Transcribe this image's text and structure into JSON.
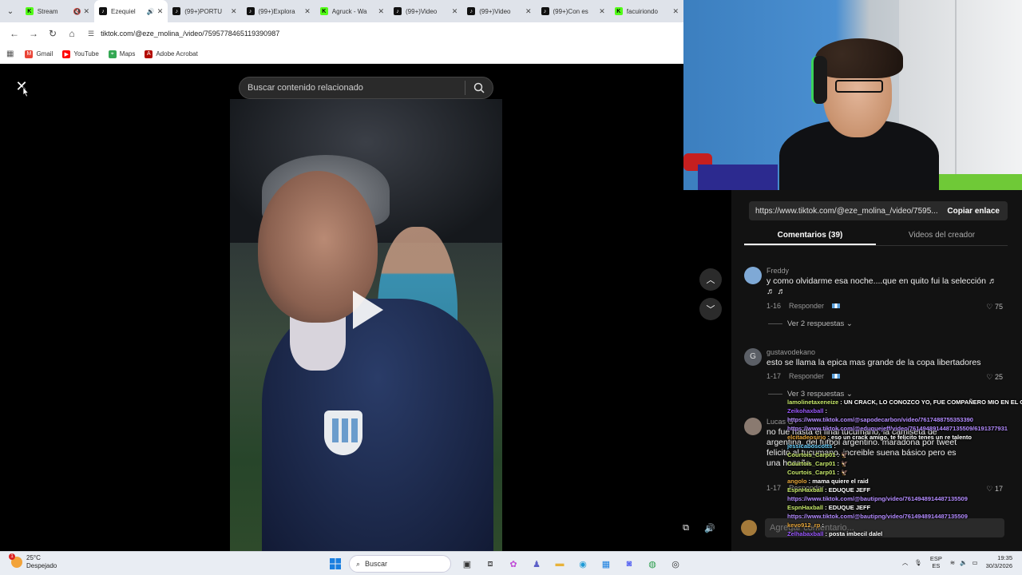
{
  "browser": {
    "tabs": [
      {
        "label": "Stream",
        "favicon": "kick",
        "active": false,
        "muted": true
      },
      {
        "label": "Ezequiel",
        "favicon": "tiktok",
        "active": true,
        "sound": true
      },
      {
        "label": "(99+)PORTU",
        "favicon": "tiktok",
        "active": false
      },
      {
        "label": "(99+)Explora",
        "favicon": "tiktok",
        "active": false
      },
      {
        "label": "Agruck - Wa",
        "favicon": "kick",
        "active": false
      },
      {
        "label": "(99+)Video",
        "favicon": "tiktok",
        "active": false
      },
      {
        "label": "(99+)Video",
        "favicon": "tiktok",
        "active": false
      },
      {
        "label": "(99+)Con es",
        "favicon": "tiktok",
        "active": false
      },
      {
        "label": "facuiriondo",
        "favicon": "kick",
        "active": false
      }
    ],
    "url": "tiktok.com/@eze_molina_/video/7595778465119390987",
    "bookmarks": [
      {
        "label": "Gmail",
        "color": "#ea4335"
      },
      {
        "label": "YouTube",
        "color": "#ff0000"
      },
      {
        "label": "Maps",
        "color": "#34a853"
      },
      {
        "label": "Adobe Acrobat",
        "color": "#b30b00"
      }
    ]
  },
  "viewer": {
    "search_placeholder": "Buscar contenido relacionado"
  },
  "panel": {
    "share_url": "https://www.tiktok.com/@eze_molina_/video/7595...",
    "copy_label": "Copiar enlace",
    "tabs": [
      "Comentarios (39)",
      "Videos del creador"
    ],
    "comments": [
      {
        "user": "Freddy",
        "text": "y como olvidarme esa noche....que en quito fui la selección ♬ ♬ ♬",
        "date": "1-16",
        "reply": "Responder",
        "likes": "75",
        "replies": "Ver 2 respuestas",
        "avatar_color": "#7fa9d6"
      },
      {
        "user": "gustavodekano",
        "text": "esto se llama la epica mas grande de la copa libertadores",
        "date": "1-17",
        "reply": "Responder",
        "likes": "25",
        "replies": "Ver 3 respuestas",
        "avatar_color": "#5b5f66",
        "avatar_letter": "G"
      },
      {
        "user": "Lucas G",
        "text": "no fue hasta el final tucumano. la camiseta de argentina. del fútbol argentino. maradona por tweet felicito al tucumano. increible suena básico pero es una hazaña",
        "date": "1-17",
        "reply": "Responder",
        "likes": "17",
        "avatar_color": "#8a7a70"
      }
    ],
    "input_placeholder": "Agregar comentario..."
  },
  "chat": [
    {
      "user": "lamolinetaxeneize",
      "text": "UN CRACK, LO CONOZCO YO, FUE COMPAÑERO MIO EN EL CANAL",
      "ucls": ""
    },
    {
      "user": "Zeikohaxball",
      "text": "",
      "ucls": "u2"
    },
    {
      "user": "",
      "text": "https://www.tiktok.com/@sapodecarbon/video/7617488755353390",
      "ucls": "lnk"
    },
    {
      "user": "",
      "text": "https://www.tiktok.com/@eduquejeff/video/7614948914487135509/6191377931",
      "ucls": "lnk"
    },
    {
      "user": "elcitadeosirio",
      "text": "eso un crack amigo, te felicito tenes un re talento",
      "ucls": "u3"
    },
    {
      "user": "jessicaboscotts",
      "text": "",
      "ucls": "u4"
    },
    {
      "user": "Courtois_Carp01",
      "text": "🦅",
      "ucls": "u"
    },
    {
      "user": "",
      "text": "",
      "ucls": ""
    },
    {
      "user": "Courtois_Carp01",
      "text": "🦅",
      "ucls": "u"
    },
    {
      "user": "Courtois_Carp01",
      "text": "🦅",
      "ucls": "u"
    },
    {
      "user": "angolo",
      "text": "mama quiere el raid",
      "ucls": "u3"
    },
    {
      "user": "EspnHaxball",
      "text": "EDUQUE JEFF",
      "ucls": "u"
    },
    {
      "user": "",
      "text": "https://www.tiktok.com/@bautipng/video/7614948914487135509",
      "ucls": "lnk"
    },
    {
      "user": "EspnHaxball",
      "text": "EDUQUE JEFF",
      "ucls": "u"
    },
    {
      "user": "",
      "text": "https://www.tiktok.com/@bautipng/video/7614948914487135509",
      "ucls": "lnk"
    },
    {
      "user": "kevo912_rp",
      "text": "",
      "ucls": "u3"
    },
    {
      "user": "Zelhabaxball",
      "text": "posta imbecil dalel",
      "ucls": "u2"
    }
  ],
  "taskbar": {
    "temp": "25°C",
    "weather": "Despejado",
    "search": "Buscar",
    "lang_top": "ESP",
    "lang_bottom": "ES",
    "time": "19:35",
    "date": "30/3/2026"
  }
}
